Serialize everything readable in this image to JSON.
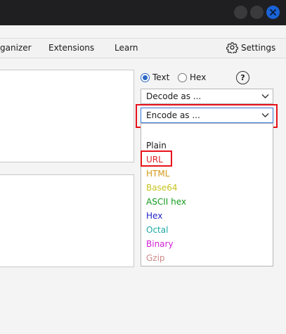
{
  "window": {
    "buttons": [
      "minimize-icon",
      "maximize-icon",
      "close-icon"
    ]
  },
  "menu": {
    "organizer": "ganizer",
    "extensions": "Extensions",
    "learn": "Learn",
    "settings": "Settings"
  },
  "mode": {
    "text_label": "Text",
    "hex_label": "Hex",
    "selected": "Text",
    "help": "?"
  },
  "decode": {
    "label": "Decode as ..."
  },
  "encode": {
    "label": "Encode as ..."
  },
  "encode_options": [
    {
      "label": "Plain",
      "color": "#1a1a1a"
    },
    {
      "label": "URL",
      "color": "#e0242c"
    },
    {
      "label": "HTML",
      "color": "#d39a17"
    },
    {
      "label": "Base64",
      "color": "#c7c41f"
    },
    {
      "label": "ASCII hex",
      "color": "#139a1c"
    },
    {
      "label": "Hex",
      "color": "#1f1fc8"
    },
    {
      "label": "Octal",
      "color": "#1fa7a3"
    },
    {
      "label": "Binary",
      "color": "#d21ed2"
    },
    {
      "label": "Gzip",
      "color": "#d08a8a"
    }
  ],
  "colors": {
    "accent": "#2b68c4",
    "highlight": "#e8121b",
    "titlebar": "#1f1f21"
  }
}
